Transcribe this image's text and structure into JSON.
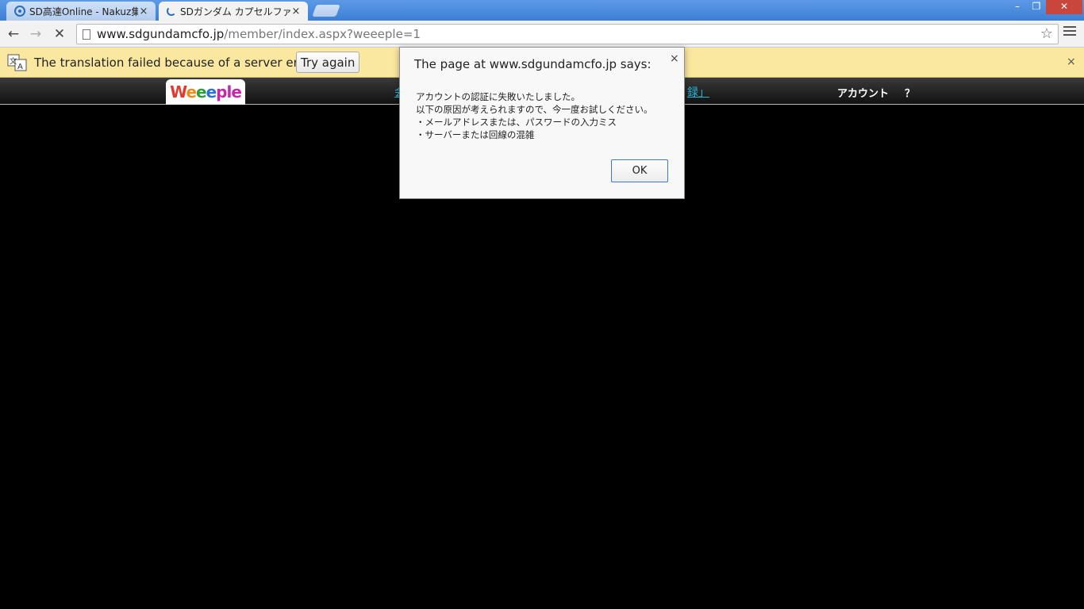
{
  "tabs": [
    {
      "title": "SD高達Online - Nakuz集",
      "close": "×"
    },
    {
      "title": "SDガンダム カプセルファ",
      "close": "×"
    }
  ],
  "window_controls": {
    "minimize": "–",
    "restore": "❐",
    "close": "✕"
  },
  "toolbar": {
    "back": "←",
    "forward": "→",
    "stop": "✕",
    "url_host": "www.sdgundamcfo.jp",
    "url_path": "/member/index.aspx?weeeple=1",
    "star": "☆"
  },
  "infobar": {
    "message": "The translation failed because of a server error.",
    "try_again": "Try again",
    "close": "×"
  },
  "site_header": {
    "logo": [
      "W",
      "e",
      "e",
      "e",
      "ple"
    ],
    "nav_left": "会",
    "nav_right": "録」",
    "account": "アカウント",
    "help": "？"
  },
  "dialog": {
    "title": "The page at www.sdgundamcfo.jp says:",
    "close": "×",
    "lines": [
      "アカウントの認証に失敗いたしました。",
      "以下の原因が考えられますので、今一度お試しください。",
      "・メールアドレスまたは、パスワードの入力ミス",
      "・サーバーまたは回線の混雑"
    ],
    "ok": "OK"
  },
  "colors": {
    "tabstrip": "#4a8fe0",
    "infobar": "#fbe8a0",
    "link": "#22b8d8",
    "dialog_ok_border": "#3b78d1"
  }
}
